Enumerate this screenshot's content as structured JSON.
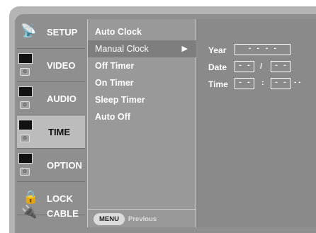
{
  "categories": [
    {
      "label": "SETUP",
      "icon": "satellite-dish-icon",
      "selected": false
    },
    {
      "label": "VIDEO",
      "icon": "video-screen-icon",
      "selected": false
    },
    {
      "label": "AUDIO",
      "icon": "audio-screen-icon",
      "selected": false
    },
    {
      "label": "TIME",
      "icon": "time-screen-icon",
      "selected": true
    },
    {
      "label": "OPTION",
      "icon": "option-screen-icon",
      "selected": false
    },
    {
      "label": "LOCK",
      "icon": "padlock-icon",
      "selected": false
    },
    {
      "label": "CABLE",
      "icon": "cable-plug-icon",
      "selected": false
    }
  ],
  "submenu": {
    "items": [
      "Auto Clock",
      "Manual Clock",
      "Off Timer",
      "On Timer",
      "Sleep Timer",
      "Auto Off"
    ],
    "highlighted": "Manual Clock",
    "arrow": "▶",
    "menu_button": "MENU",
    "previous_label": "Previous"
  },
  "fields": {
    "year_label": "Year",
    "year_value": "- - - -",
    "date_label": "Date",
    "date_month": "- -",
    "date_sep": "/",
    "date_day": "- -",
    "time_label": "Time",
    "time_hour": "- -",
    "time_sep": ":",
    "time_minute": "- -",
    "time_ampm": "- -"
  },
  "colors": {
    "frame": "#b4b4b4",
    "screen": "#8f8f8f",
    "selected_category": "#bcbcbc",
    "highlight_row": "#7e7e7e"
  }
}
